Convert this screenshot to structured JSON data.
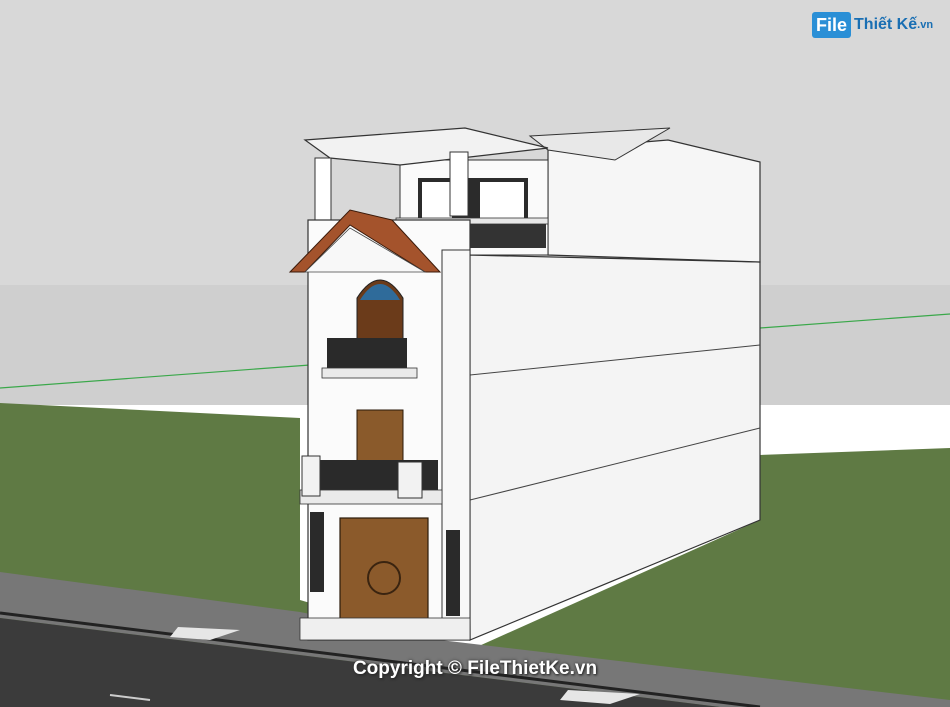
{
  "watermark": {
    "logo_file": "File",
    "logo_rest": "Thiết Kế",
    "logo_domain": ".vn",
    "copyright": "Copyright © FileThietKe.vn"
  },
  "colors": {
    "sky": "#d9d9d9",
    "grass": "#5e7a45",
    "road": "#3a3a3a",
    "sidewalk": "#6a6a6a",
    "wall": "#ffffff",
    "roof_tile": "#a0522d",
    "door": "#8b5a2b"
  }
}
